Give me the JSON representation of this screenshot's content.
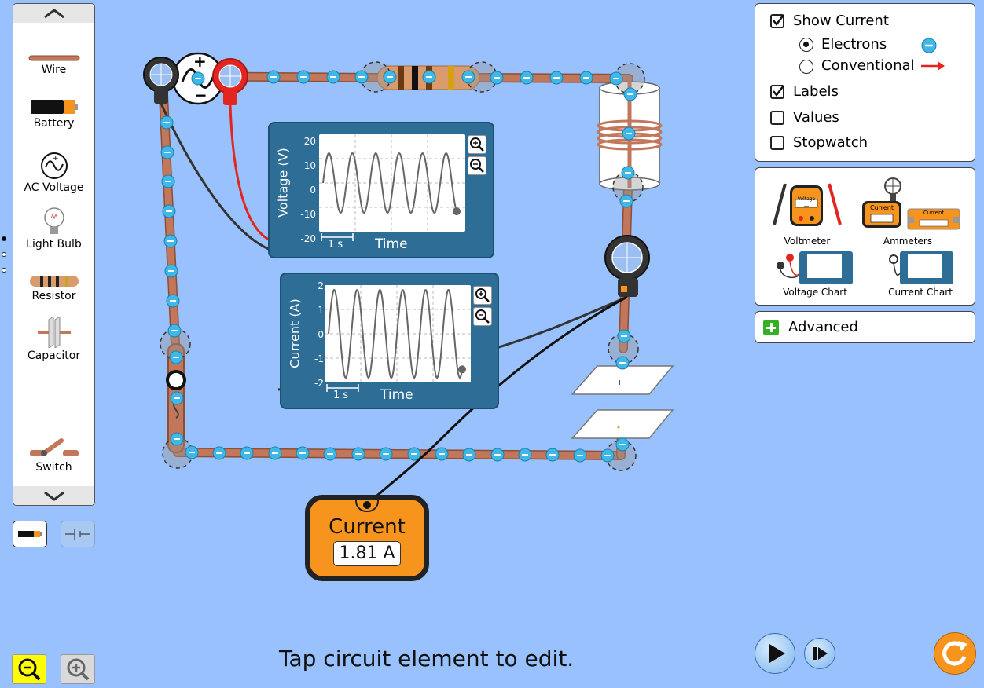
{
  "toolbox": {
    "items": [
      {
        "label": "Wire",
        "icon": "wire-icon"
      },
      {
        "label": "Battery",
        "icon": "battery-icon"
      },
      {
        "label": "AC Voltage",
        "icon": "ac-voltage-icon"
      },
      {
        "label": "Light Bulb",
        "icon": "light-bulb-icon"
      },
      {
        "label": "Resistor",
        "icon": "resistor-icon"
      },
      {
        "label": "Capacitor",
        "icon": "capacitor-icon"
      },
      {
        "label": "Switch",
        "icon": "switch-icon"
      }
    ],
    "up_icon": "chevron-up-icon",
    "down_icon": "chevron-down-icon",
    "pages": 3,
    "active_page": 1
  },
  "view_toggle": {
    "lifelike_icon": "battery-lifelike-icon",
    "schematic_icon": "battery-schematic-icon",
    "selected": "lifelike"
  },
  "display_panel": {
    "show_current": {
      "label": "Show Current",
      "checked": true
    },
    "electrons": {
      "label": "Electrons",
      "selected": true,
      "icon": "electron-icon"
    },
    "conventional": {
      "label": "Conventional",
      "selected": false,
      "icon": "red-arrow-icon"
    },
    "labels": {
      "label": "Labels",
      "checked": true
    },
    "values": {
      "label": "Values",
      "checked": false
    },
    "stopwatch": {
      "label": "Stopwatch",
      "checked": false
    }
  },
  "sensor_panel": {
    "voltmeter": {
      "label": "Voltmeter",
      "device_text": "Voltage",
      "reading": "—"
    },
    "ammeters": {
      "label": "Ammeters",
      "device_text": "Current",
      "device_text_2": "Current",
      "reading": "—"
    },
    "voltage_chart": {
      "label": "Voltage Chart"
    },
    "current_chart": {
      "label": "Current Chart"
    }
  },
  "advanced": {
    "label": "Advanced",
    "icon": "plus-icon"
  },
  "voltage_chart": {
    "ylabel": "Voltage (V)",
    "xlabel": "Time",
    "scale_label": "1 s",
    "ticks": [
      "20",
      "10",
      "0",
      "-10",
      "-20"
    ],
    "zoom_in_icon": "zoom-in-icon",
    "zoom_out_icon": "zoom-out-icon"
  },
  "current_chart": {
    "ylabel": "Current (A)",
    "xlabel": "Time",
    "scale_label": "1 s",
    "ticks": [
      "2",
      "1",
      "0",
      "-1",
      "-2"
    ],
    "zoom_in_icon": "zoom-in-icon",
    "zoom_out_icon": "zoom-out-icon"
  },
  "ammeter_device": {
    "title": "Current",
    "reading": "1.81 A"
  },
  "status_text": "Tap circuit element to edit.",
  "bottom": {
    "zoom_out_icon": "zoom-out-icon",
    "zoom_in_icon": "zoom-in-icon",
    "play_icon": "play-icon",
    "step_icon": "step-forward-icon",
    "reset_icon": "reset-icon"
  },
  "colors": {
    "background": "#99c1fe",
    "wire": "#c2765a",
    "electron": "#3fb8e8",
    "chart_panel": "#2e6e96",
    "meter_orange": "#f7941d",
    "accent_yellow": "#ffff00",
    "reset_orange": "#f7941d",
    "advanced_green": "#33b023"
  }
}
